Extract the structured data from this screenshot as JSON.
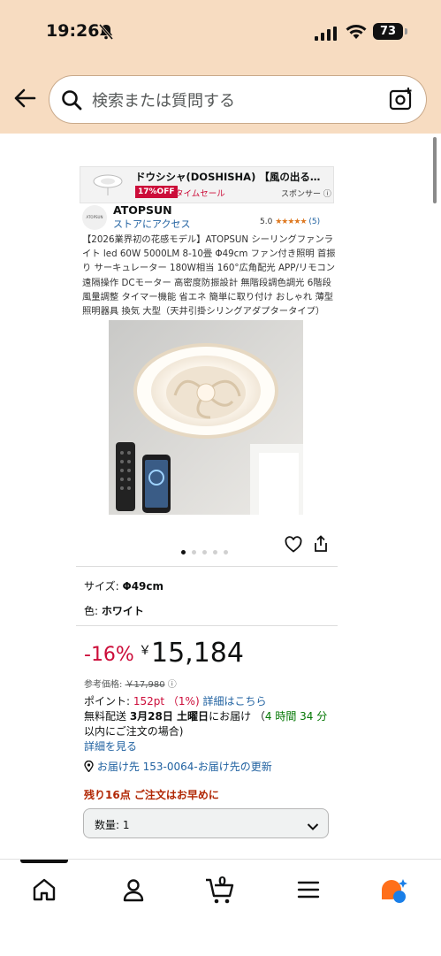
{
  "status_bar": {
    "time": "19:26",
    "battery": "73"
  },
  "search": {
    "placeholder": "検索または質問する"
  },
  "sponsored": {
    "title": "ドウシシャ(DOSHISHA) 【風の出る照明…",
    "badge": "17%OFF",
    "deal": "タイムセール",
    "sponsor_label": "スポンサー"
  },
  "brand": {
    "logo_text": "ATOPSUN",
    "name": "ATOPSUN",
    "store_link": "ストアにアクセス",
    "rating": "5.0",
    "stars": "★★★★★",
    "review_count": "(5)"
  },
  "product": {
    "title": "【2026業界初の花感モデル】ATOPSUN シーリングファンライト led 60W 5000LM 8-10畳 Φ49cm ファン付き照明 首振り サーキュレーター 180W相当 160°広角配光 APP/リモコン遠隔操作 DCモーター 高密度防振設計 無階段調色調光 6階段風量調整 タイマー機能 省エネ 簡単に取り付け おしゃれ 薄型 照明器具 換気 大型（天井引掛シリングアダプタータイプ）",
    "image_count": 5,
    "active_image": 0
  },
  "variations": {
    "size_label": "サイズ: ",
    "size_value": "Φ49cm",
    "color_label": "色: ",
    "color_value": "ホワイト"
  },
  "pricing": {
    "discount": "-16%",
    "currency": "￥",
    "price": "15,184",
    "ref_label": "参考価格: ",
    "ref_price": "￥17,980",
    "points_label": "ポイント: ",
    "points_value": "152pt （1%)",
    "points_link": "詳細はこちら"
  },
  "delivery": {
    "prefix": "無料配送 ",
    "date": "3月28日 土曜日",
    "suffix": "にお届け （",
    "countdown": "4 時間 34 分",
    "tail": "以内にご注文の場合)",
    "details_link": "詳細を見る"
  },
  "address": {
    "text": "お届け先 153-0064-お届け先の更新"
  },
  "stock": {
    "text": "残り16点 ご注文はお早めに"
  },
  "quantity": {
    "label": "数量: 1"
  },
  "tabbar": {
    "cart_count": "0"
  },
  "colors": {
    "header_bg": "#f7dcc1",
    "price_red": "#cc0c39",
    "link_blue": "#2162a1",
    "delivery_green": "#007600",
    "star_orange": "#de7921"
  }
}
